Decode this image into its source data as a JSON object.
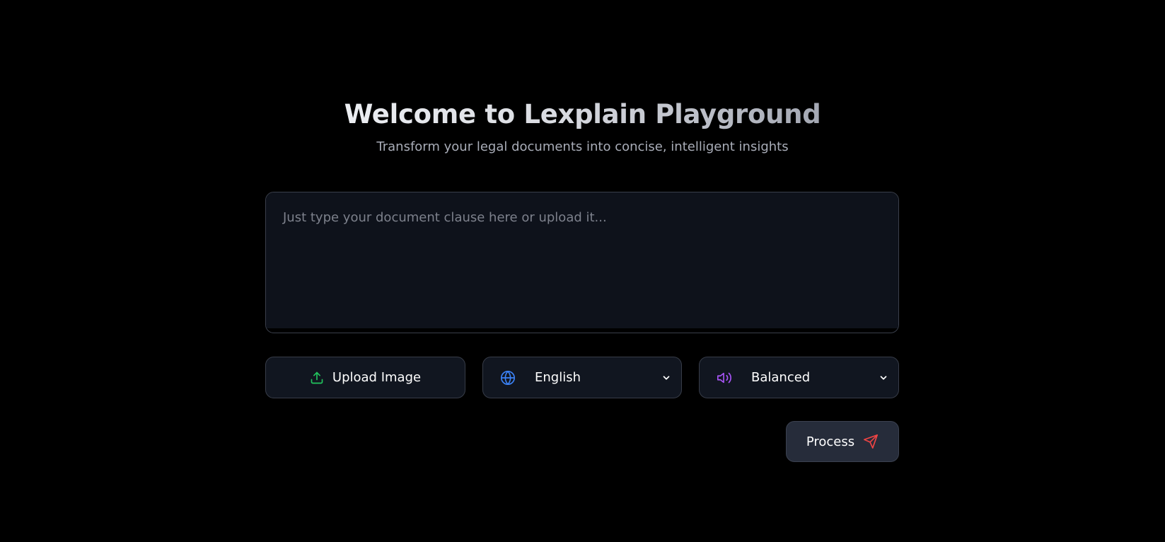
{
  "header": {
    "title": "Welcome to Lexplain Playground",
    "subtitle": "Transform your legal documents into concise, intelligent insights"
  },
  "editor": {
    "placeholder": "Just type your document clause here or upload it...",
    "value": ""
  },
  "controls": {
    "upload": {
      "label": "Upload Image",
      "icon": "upload-icon",
      "icon_color": "#22c55e"
    },
    "language": {
      "selected": "English",
      "icon": "globe-icon",
      "icon_color": "#3b82f6"
    },
    "tone": {
      "selected": "Balanced",
      "icon": "speaker-icon",
      "icon_color": "#a855f7"
    }
  },
  "process": {
    "label": "Process",
    "icon": "send-icon",
    "icon_color": "#ef4444"
  },
  "colors": {
    "background": "#000000",
    "panel": "#111620",
    "editor_bg": "#0e121b",
    "border": "#373c48",
    "process_bg": "#262c3a"
  }
}
